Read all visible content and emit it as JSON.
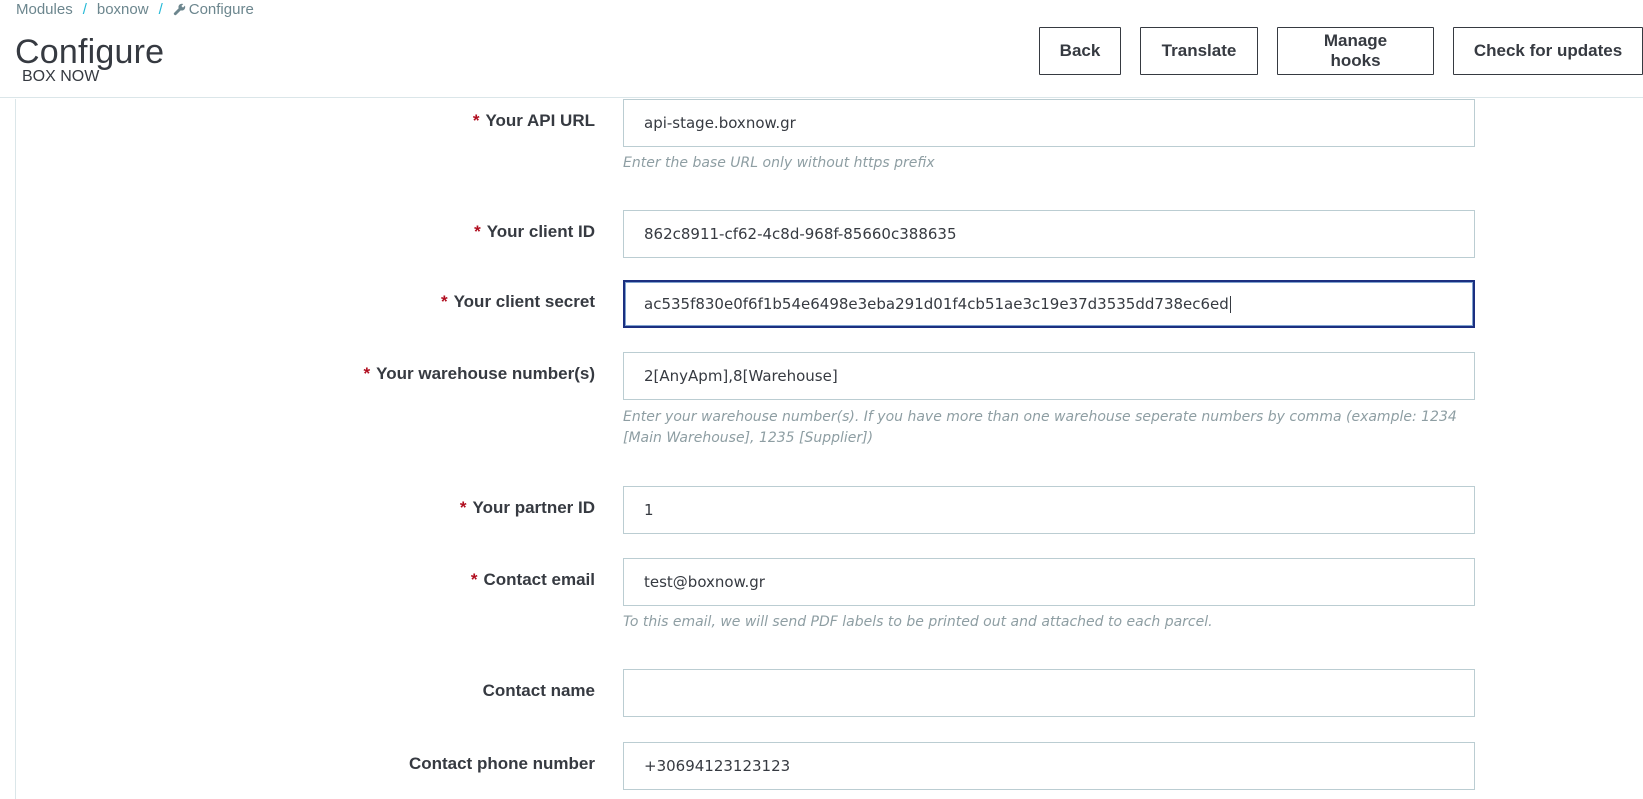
{
  "breadcrumb": {
    "items": [
      "Modules",
      "boxnow",
      "Configure"
    ],
    "separator": "/"
  },
  "page": {
    "title": "Configure",
    "subtitle": "BOX NOW"
  },
  "toolbar": {
    "back_label": "Back",
    "translate_label": "Translate",
    "manage_hooks_label": "Manage hooks",
    "check_updates_label": "Check for updates"
  },
  "form": {
    "required_mark": "*",
    "fields": [
      {
        "label": "Your API URL",
        "value": "api-stage.boxnow.gr",
        "help": "Enter the base URL only without https prefix",
        "required": true
      },
      {
        "label": "Your client ID",
        "value": "862c8911-cf62-4c8d-968f-85660c388635",
        "help": "",
        "required": true
      },
      {
        "label": "Your client secret",
        "value": "ac535f830e0f6f1b54e6498e3eba291d01f4cb51ae3c19e37d3535dd738ec6ed",
        "help": "",
        "required": true
      },
      {
        "label": "Your warehouse number(s)",
        "value": "2[AnyApm],8[Warehouse]",
        "help": "Enter your warehouse number(s). If you have more than one warehouse seperate numbers by comma (example: 1234 [Main Warehouse], 1235 [Supplier])",
        "required": true
      },
      {
        "label": "Your partner ID",
        "value": "1",
        "help": "",
        "required": true
      },
      {
        "label": "Contact email",
        "value": "test@boxnow.gr",
        "help": "To this email, we will send PDF labels to be printed out and attached to each parcel.",
        "required": true
      },
      {
        "label": "Contact name",
        "value": "",
        "help": "",
        "required": false
      },
      {
        "label": "Contact phone number",
        "value": "+30694123123123",
        "help": "",
        "required": false
      }
    ]
  },
  "colors": {
    "required": "#b00c1e",
    "focus_border": "#1b2f80",
    "accent": "#25b9d7"
  }
}
